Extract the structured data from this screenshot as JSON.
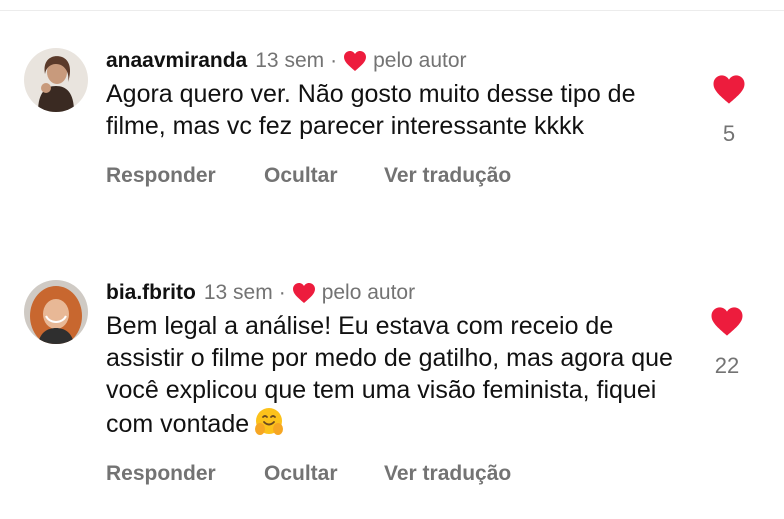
{
  "colors": {
    "like_red": "#ed1c3d",
    "muted_gray": "#737373",
    "text": "#111111"
  },
  "comments": [
    {
      "username": "anaavmiranda",
      "time": "13 sem",
      "separator": "·",
      "liked_by_author_icon": "heart-icon",
      "liked_by_author_label": "pelo autor",
      "text": "Agora quero ver. Não gosto muito desse tipo de filme, mas vc fez parecer interessante kkkk",
      "like_count": "5",
      "actions": {
        "reply": "Responder",
        "hide": "Ocultar",
        "translate": "Ver tradução"
      }
    },
    {
      "username": "bia.fbrito",
      "time": "13 sem",
      "separator": "·",
      "liked_by_author_icon": "heart-icon",
      "liked_by_author_label": "pelo autor",
      "text": "Bem legal a análise! Eu estava com receio de assistir o filme por medo de gatilho, mas agora que você explicou que tem uma visão feminista, fiquei com vontade",
      "emoji": "hugging-face-emoji",
      "like_count": "22",
      "actions": {
        "reply": "Responder",
        "hide": "Ocultar",
        "translate": "Ver tradução"
      }
    }
  ]
}
